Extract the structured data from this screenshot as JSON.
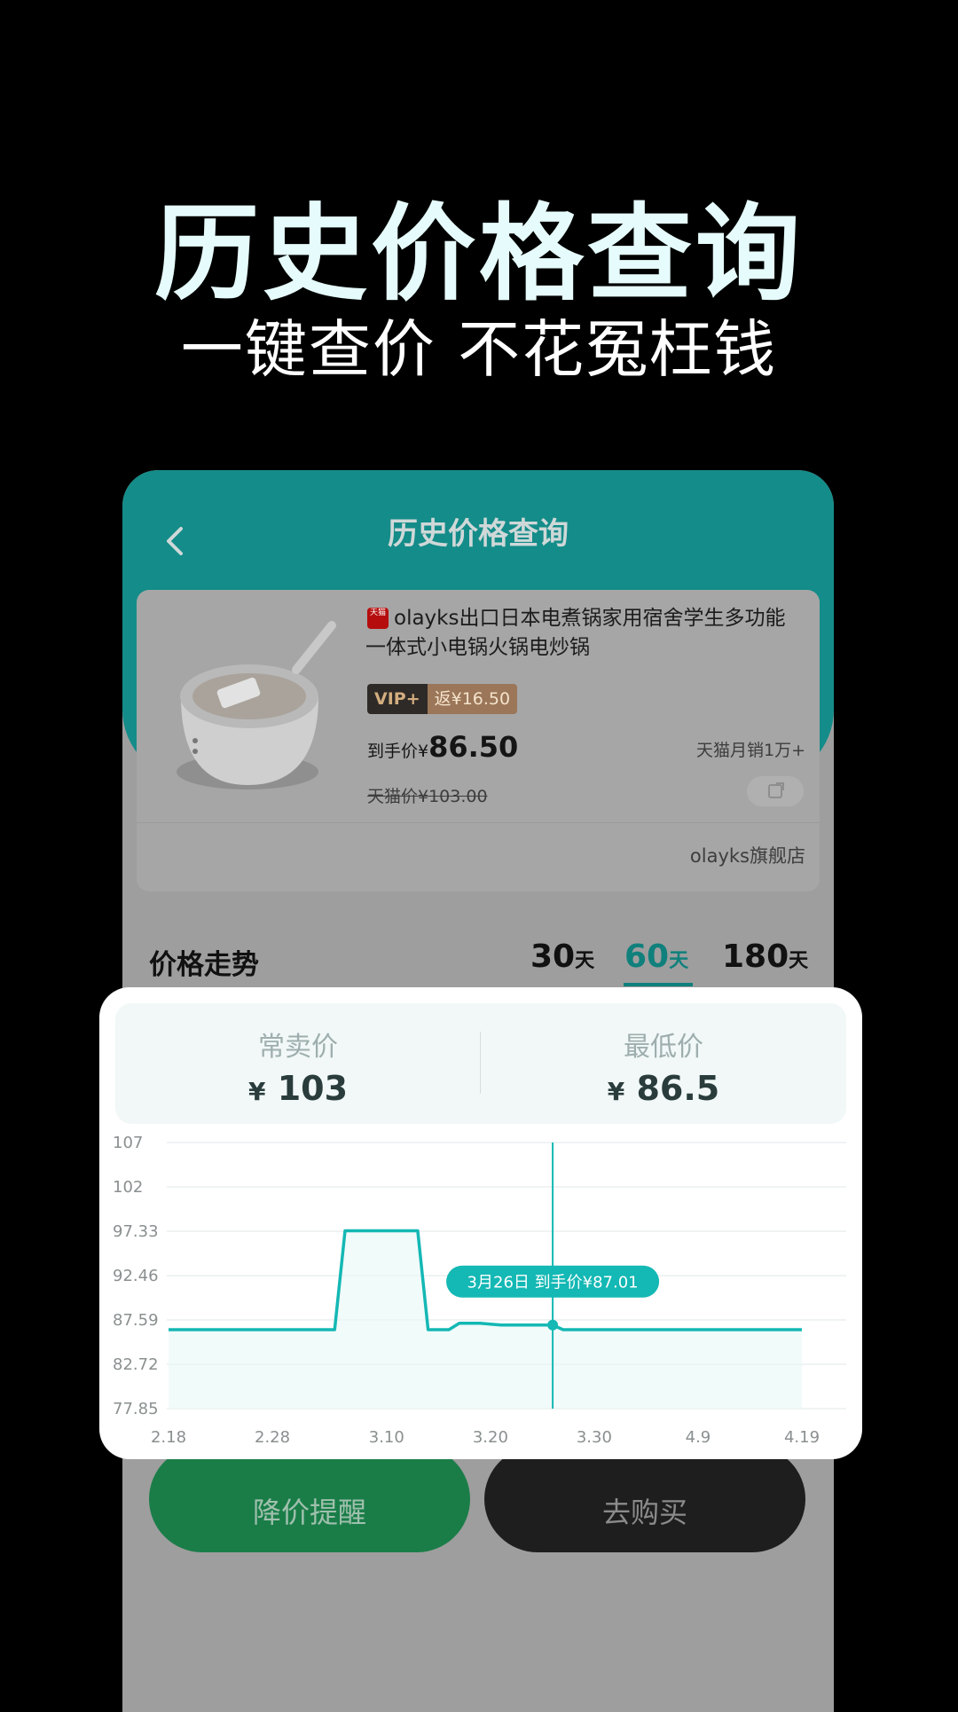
{
  "hero": {
    "title": "历史价格查询",
    "subtitle": "一键查价 不花冤枉钱"
  },
  "header": {
    "title": "历史价格查询"
  },
  "product": {
    "platform_badge": "天猫",
    "name": "olayks出口日本电煮锅家用宿舍学生多功能一体式小电锅火锅电炒锅",
    "vip_label": "VIP+",
    "rebate": "返¥16.50",
    "final_price_label": "到手价¥",
    "final_price": "86.50",
    "monthly_sales": "天猫月销1万+",
    "tmall_price": "天猫价¥103.00",
    "shop": "olayks旗舰店"
  },
  "trend": {
    "label": "价格走势",
    "periods": [
      {
        "value": "30",
        "unit": "天",
        "active": false
      },
      {
        "value": "60",
        "unit": "天",
        "active": true
      },
      {
        "value": "180",
        "unit": "天",
        "active": false
      }
    ]
  },
  "stats": {
    "usual_label": "常卖价",
    "usual_value": "103",
    "lowest_label": "最低价",
    "lowest_value": "86.5",
    "currency": "¥"
  },
  "buttons": {
    "remind": "降价提醒",
    "buy": "去购买"
  },
  "colors": {
    "accent": "#14b8b4",
    "header_teal": "#148c89",
    "remind_green": "#1a7d48"
  },
  "chart_data": {
    "type": "line",
    "x_labels": [
      "2.18",
      "2.28",
      "3.10",
      "3.20",
      "3.30",
      "4.9",
      "4.19"
    ],
    "y_ticks": [
      "107",
      "102",
      "97.33",
      "92.46",
      "87.59",
      "82.72",
      "77.85"
    ],
    "ylim": [
      77.85,
      107
    ],
    "grid": true,
    "series": [
      {
        "x": [
          "2.18",
          "3.05",
          "3.06",
          "3.13",
          "3.14",
          "3.16",
          "3.17",
          "3.19",
          "3.21",
          "3.26",
          "3.27",
          "4.19"
        ],
        "y": [
          86.5,
          86.5,
          97.33,
          97.33,
          86.5,
          86.5,
          87.2,
          87.2,
          87.01,
          87.01,
          86.5,
          86.5
        ]
      }
    ],
    "tooltip": {
      "x": "3.26",
      "text": "3月26日 到手价¥87.01",
      "value": 87.01
    }
  }
}
